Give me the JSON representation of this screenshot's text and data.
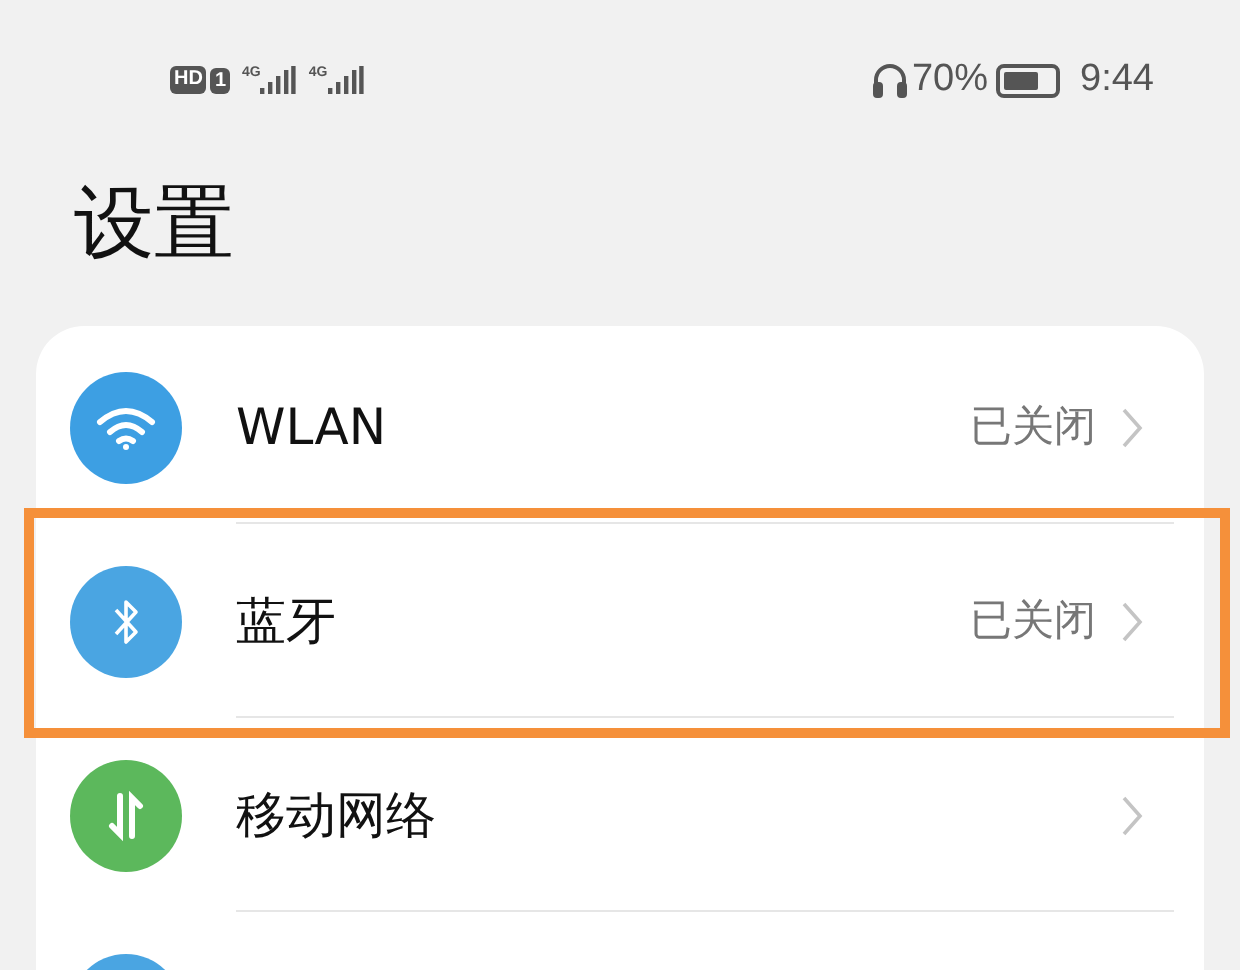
{
  "status_bar": {
    "left": [
      {
        "kind": "badge",
        "text": "HD"
      },
      {
        "kind": "sim",
        "text": "1"
      },
      {
        "kind": "signal",
        "text": "4G"
      },
      {
        "kind": "signal",
        "text": "4G"
      }
    ],
    "battery_text": "70%",
    "time": "9:44"
  },
  "title": "设置",
  "items": [
    {
      "kind": "wifi",
      "color": "#3d9fe3",
      "label": "WLAN",
      "value": "已关闭",
      "highlighted": false
    },
    {
      "kind": "bluetooth",
      "color": "#4aa5e2",
      "label": "蓝牙",
      "value": "已关闭",
      "highlighted": true
    },
    {
      "kind": "mobile-data",
      "color": "#5cb85c",
      "label": "移动网络",
      "highlighted": false
    },
    {
      "kind": "blank",
      "color": "#4aa5e2",
      "highlighted": false
    }
  ]
}
